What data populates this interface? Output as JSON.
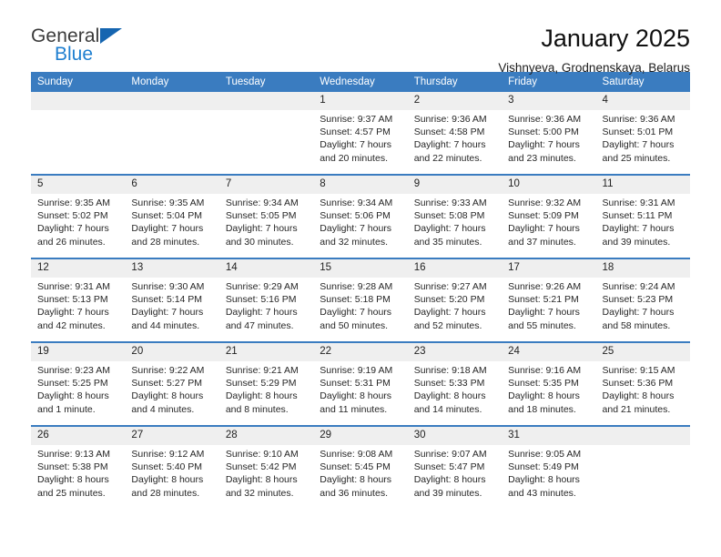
{
  "brand": {
    "line1": "General",
    "line2": "Blue",
    "triangle_icon": "blue-triangle-logo-mark",
    "colors": {
      "general": "#3b3b3b",
      "blue": "#1f7fd0",
      "triangle": "#1565b0"
    }
  },
  "header": {
    "title": "January 2025",
    "subtitle": "Vishnyeva, Grodnenskaya, Belarus"
  },
  "theme": {
    "header_band": "#3a7cc0",
    "day_number_band": "#efefef",
    "week_separator": "#3a7cc0",
    "text": "#262626"
  },
  "weekday_headers": [
    "Sunday",
    "Monday",
    "Tuesday",
    "Wednesday",
    "Thursday",
    "Friday",
    "Saturday"
  ],
  "weeks": [
    [
      {
        "day": "",
        "info": ""
      },
      {
        "day": "",
        "info": ""
      },
      {
        "day": "",
        "info": ""
      },
      {
        "day": "1",
        "info": "Sunrise: 9:37 AM\nSunset: 4:57 PM\nDaylight: 7 hours\nand 20 minutes."
      },
      {
        "day": "2",
        "info": "Sunrise: 9:36 AM\nSunset: 4:58 PM\nDaylight: 7 hours\nand 22 minutes."
      },
      {
        "day": "3",
        "info": "Sunrise: 9:36 AM\nSunset: 5:00 PM\nDaylight: 7 hours\nand 23 minutes."
      },
      {
        "day": "4",
        "info": "Sunrise: 9:36 AM\nSunset: 5:01 PM\nDaylight: 7 hours\nand 25 minutes."
      }
    ],
    [
      {
        "day": "5",
        "info": "Sunrise: 9:35 AM\nSunset: 5:02 PM\nDaylight: 7 hours\nand 26 minutes."
      },
      {
        "day": "6",
        "info": "Sunrise: 9:35 AM\nSunset: 5:04 PM\nDaylight: 7 hours\nand 28 minutes."
      },
      {
        "day": "7",
        "info": "Sunrise: 9:34 AM\nSunset: 5:05 PM\nDaylight: 7 hours\nand 30 minutes."
      },
      {
        "day": "8",
        "info": "Sunrise: 9:34 AM\nSunset: 5:06 PM\nDaylight: 7 hours\nand 32 minutes."
      },
      {
        "day": "9",
        "info": "Sunrise: 9:33 AM\nSunset: 5:08 PM\nDaylight: 7 hours\nand 35 minutes."
      },
      {
        "day": "10",
        "info": "Sunrise: 9:32 AM\nSunset: 5:09 PM\nDaylight: 7 hours\nand 37 minutes."
      },
      {
        "day": "11",
        "info": "Sunrise: 9:31 AM\nSunset: 5:11 PM\nDaylight: 7 hours\nand 39 minutes."
      }
    ],
    [
      {
        "day": "12",
        "info": "Sunrise: 9:31 AM\nSunset: 5:13 PM\nDaylight: 7 hours\nand 42 minutes."
      },
      {
        "day": "13",
        "info": "Sunrise: 9:30 AM\nSunset: 5:14 PM\nDaylight: 7 hours\nand 44 minutes."
      },
      {
        "day": "14",
        "info": "Sunrise: 9:29 AM\nSunset: 5:16 PM\nDaylight: 7 hours\nand 47 minutes."
      },
      {
        "day": "15",
        "info": "Sunrise: 9:28 AM\nSunset: 5:18 PM\nDaylight: 7 hours\nand 50 minutes."
      },
      {
        "day": "16",
        "info": "Sunrise: 9:27 AM\nSunset: 5:20 PM\nDaylight: 7 hours\nand 52 minutes."
      },
      {
        "day": "17",
        "info": "Sunrise: 9:26 AM\nSunset: 5:21 PM\nDaylight: 7 hours\nand 55 minutes."
      },
      {
        "day": "18",
        "info": "Sunrise: 9:24 AM\nSunset: 5:23 PM\nDaylight: 7 hours\nand 58 minutes."
      }
    ],
    [
      {
        "day": "19",
        "info": "Sunrise: 9:23 AM\nSunset: 5:25 PM\nDaylight: 8 hours\nand 1 minute."
      },
      {
        "day": "20",
        "info": "Sunrise: 9:22 AM\nSunset: 5:27 PM\nDaylight: 8 hours\nand 4 minutes."
      },
      {
        "day": "21",
        "info": "Sunrise: 9:21 AM\nSunset: 5:29 PM\nDaylight: 8 hours\nand 8 minutes."
      },
      {
        "day": "22",
        "info": "Sunrise: 9:19 AM\nSunset: 5:31 PM\nDaylight: 8 hours\nand 11 minutes."
      },
      {
        "day": "23",
        "info": "Sunrise: 9:18 AM\nSunset: 5:33 PM\nDaylight: 8 hours\nand 14 minutes."
      },
      {
        "day": "24",
        "info": "Sunrise: 9:16 AM\nSunset: 5:35 PM\nDaylight: 8 hours\nand 18 minutes."
      },
      {
        "day": "25",
        "info": "Sunrise: 9:15 AM\nSunset: 5:36 PM\nDaylight: 8 hours\nand 21 minutes."
      }
    ],
    [
      {
        "day": "26",
        "info": "Sunrise: 9:13 AM\nSunset: 5:38 PM\nDaylight: 8 hours\nand 25 minutes."
      },
      {
        "day": "27",
        "info": "Sunrise: 9:12 AM\nSunset: 5:40 PM\nDaylight: 8 hours\nand 28 minutes."
      },
      {
        "day": "28",
        "info": "Sunrise: 9:10 AM\nSunset: 5:42 PM\nDaylight: 8 hours\nand 32 minutes."
      },
      {
        "day": "29",
        "info": "Sunrise: 9:08 AM\nSunset: 5:45 PM\nDaylight: 8 hours\nand 36 minutes."
      },
      {
        "day": "30",
        "info": "Sunrise: 9:07 AM\nSunset: 5:47 PM\nDaylight: 8 hours\nand 39 minutes."
      },
      {
        "day": "31",
        "info": "Sunrise: 9:05 AM\nSunset: 5:49 PM\nDaylight: 8 hours\nand 43 minutes."
      },
      {
        "day": "",
        "info": ""
      }
    ]
  ]
}
